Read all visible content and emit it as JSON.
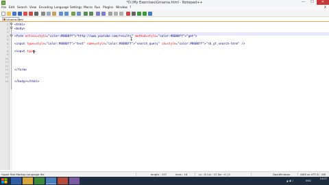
{
  "window": {
    "title": "*D:\\My Exercises\\Gmama.html - Notepad++",
    "minimize": "—",
    "maximize": "☐",
    "close": "✕"
  },
  "menu": [
    "File",
    "Edit",
    "Search",
    "View",
    "Encoding",
    "Language",
    "Settings",
    "Macro",
    "Run",
    "Plugins",
    "Window",
    "?"
  ],
  "menu_close": "X",
  "tab": {
    "label": "Gmama.html"
  },
  "editor": {
    "lines": [
      {
        "num": "1",
        "text": "<html>"
      },
      {
        "num": "2",
        "text": "<body>"
      },
      {
        "num": "3",
        "text": ""
      },
      {
        "num": "4",
        "text": "<form action=\"http://www.youtube.com/results\" method=\"get\">"
      },
      {
        "num": "5",
        "text": ""
      },
      {
        "num": "6",
        "text": "<input type=\"text\" name=\"search_query\" id=\"rb_yt_search-term\" />"
      },
      {
        "num": "7",
        "text": ""
      },
      {
        "num": "8",
        "text": "<input type="
      },
      {
        "num": "9",
        "text": ""
      },
      {
        "num": "10",
        "text": ""
      },
      {
        "num": "11",
        "text": ""
      },
      {
        "num": "12",
        "text": ""
      },
      {
        "num": "13",
        "text": "</form>"
      },
      {
        "num": "14",
        "text": ""
      },
      {
        "num": "15",
        "text": ""
      },
      {
        "num": "16",
        "text": "</body></html>"
      }
    ]
  },
  "status": {
    "language": "Hyper Text Markup Language file",
    "length": "length : 197",
    "lines": "lines : 16",
    "position": "Ln : 8   Col : 12   Sel : 0 | 0",
    "eol": "Dos\\Windows",
    "encoding": "ANSI as UTF-8",
    "mode": "INS"
  },
  "taskbar": {
    "tray_lang": "ENG",
    "clock": "14:07"
  },
  "colors": {
    "tag": "#000080",
    "string": "#8000ff",
    "attr": "#ff0000",
    "taskbar": "#1e2d3f"
  }
}
